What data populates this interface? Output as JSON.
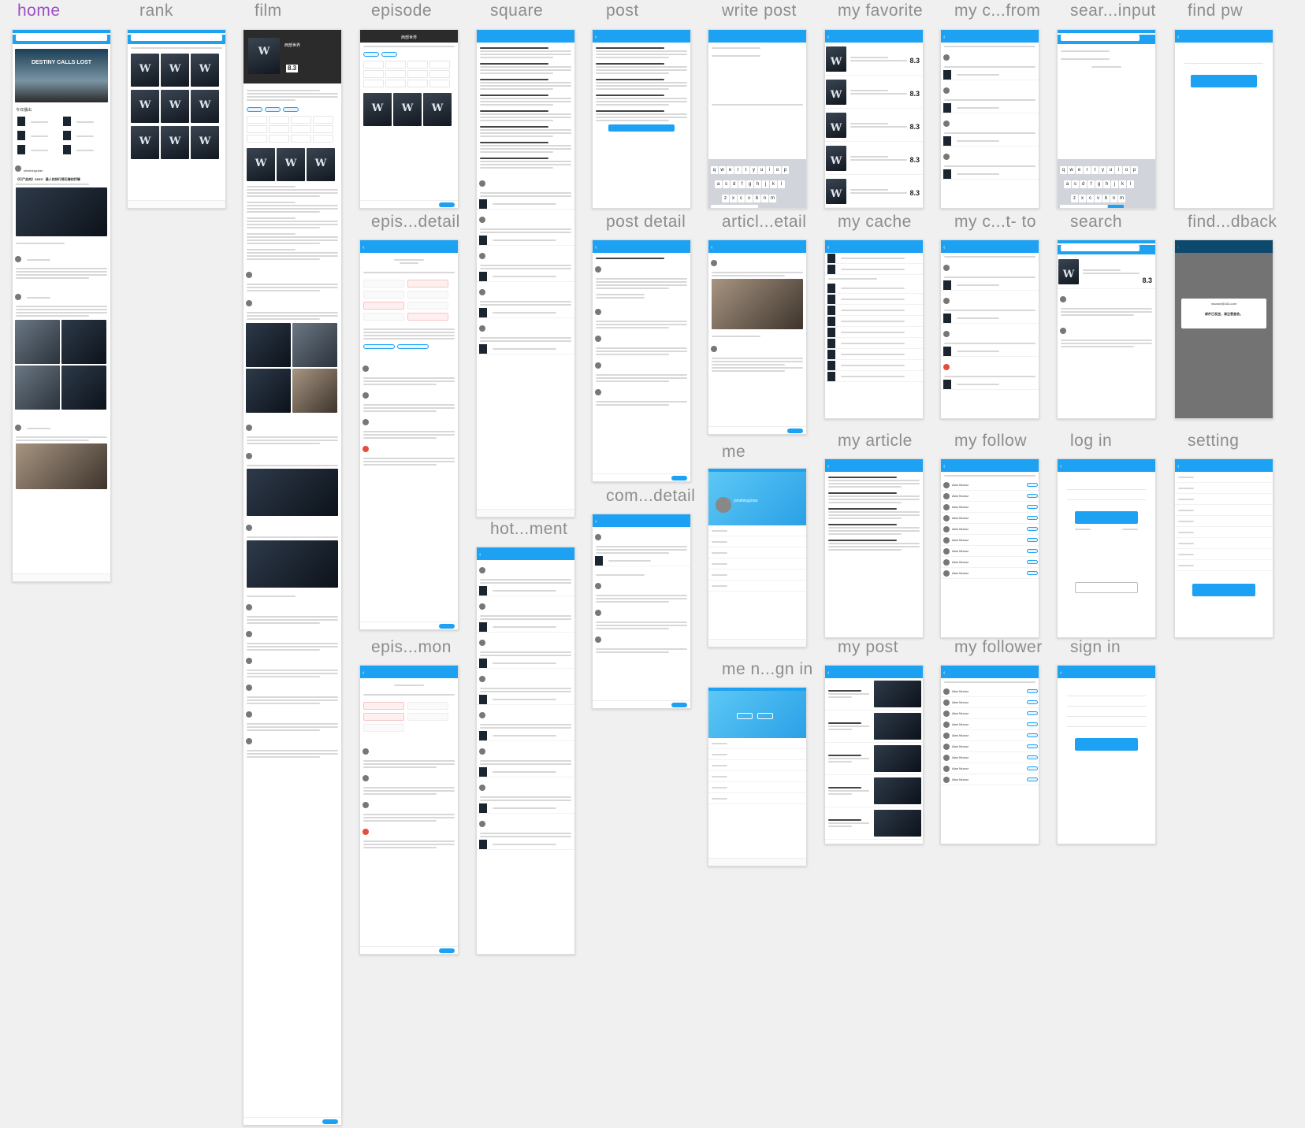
{
  "canvas": {
    "background": "#f0f0f0"
  },
  "colors": {
    "accent": "#1da1f2",
    "label": "#8d8d8d",
    "label_active": "#9b4fc6"
  },
  "labels": {
    "home": "home",
    "rank": "rank",
    "film": "film",
    "episode": "episode",
    "square": "square",
    "post": "post",
    "write_post": "write post",
    "my_favorite": "my favorite",
    "my_c_from": "my c...from",
    "sear_input": "sear...input",
    "find_pw": "find pw",
    "epis_detail": "epis...detail",
    "post_detail": "post detail",
    "articl_etail": "articl...etail",
    "my_cache": "my cache",
    "my_c_t_to": "my c...t- to",
    "search": "search",
    "find_dback": "find...dback",
    "me": "me",
    "com_detail": "com...detail",
    "hot_ment": "hot...ment",
    "my_article": "my article",
    "my_follow": "my follow",
    "log_in": "log in",
    "setting": "setting",
    "epis_mon": "epis...mon",
    "me_n_gn_in": "me n...gn in",
    "my_post": "my post",
    "my_follower": "my follower",
    "sign_in": "sign in"
  },
  "screens": {
    "home": {
      "title": "DESTINY CALLS LOST",
      "section": "今日播出",
      "author": "yimshingchan",
      "headline": "《行尸走肉》S6E5：最人的排行榜无情的抒情"
    },
    "film": {
      "score": "8.3",
      "title": "西部世界"
    },
    "episode": {
      "title": "西部世界",
      "cells": [
        "01",
        "02",
        "03",
        "04",
        "05",
        "06",
        "07",
        "08",
        "09",
        "10",
        "11",
        "12"
      ]
    },
    "my_favorite": {
      "scores": [
        "8.3",
        "8.3",
        "8.3",
        "8.3",
        "8.3"
      ]
    },
    "keyboard": {
      "row1": [
        "q",
        "w",
        "e",
        "r",
        "t",
        "y",
        "u",
        "i",
        "o",
        "p"
      ],
      "row2": [
        "a",
        "s",
        "d",
        "f",
        "g",
        "h",
        "j",
        "k",
        "l"
      ],
      "row3": [
        "z",
        "x",
        "c",
        "v",
        "b",
        "n",
        "m"
      ]
    },
    "search": {
      "score": "8.3"
    },
    "me": {
      "username": "yimshingchan"
    },
    "find_feedback": {
      "email": "maxxie@163.com",
      "message": "邮件已发送，请注意查收。"
    },
    "follow": {
      "name": "Alan Munoz"
    }
  }
}
